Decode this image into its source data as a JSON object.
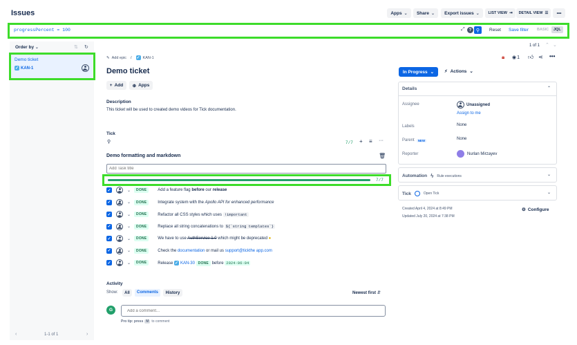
{
  "header": {
    "title": "Issues",
    "apps_label": "Apps",
    "share_label": "Share",
    "export_label": "Export issues",
    "list_view_label": "LIST VIEW",
    "detail_view_label": "DETAIL VIEW",
    "more_label": "•••"
  },
  "search": {
    "query": "progressPercent = 100",
    "reset_label": "Reset",
    "save_filter_label": "Save filter",
    "basic_label": "BASIC",
    "jql_label": "JQL"
  },
  "sidebar": {
    "order_by_label": "Order by",
    "items": [
      {
        "title": "Demo ticket",
        "key": "KAN-1"
      }
    ],
    "pagination": "1-1 of 1"
  },
  "issue": {
    "breadcrumb_add_epic": "Add epic",
    "breadcrumb_key": "KAN-1",
    "title": "Demo ticket",
    "add_label": "Add",
    "apps_label": "Apps",
    "description_heading": "Description",
    "description_text": "This ticket will be used to created demo videos for Tick documentation.",
    "pager": "1 of 1",
    "watchers": "1"
  },
  "tick": {
    "heading": "Tick",
    "count": "7/7",
    "list_title": "Demo formatting and markdown",
    "add_task_placeholder": "Add Task title",
    "progress_text": "7/7",
    "progress_percent": 100,
    "done_label": "DONE",
    "tasks": [
      {
        "a": "Add a feature flag ",
        "b": "before",
        "c": " our ",
        "d": "release"
      },
      {
        "a": "Integrate system with the ",
        "b": "Apollo API",
        "c": " for enhanced performance"
      },
      {
        "a": "Refactor all CSS styles which uses ",
        "code": "!important"
      },
      {
        "a": "Replace all string concatenations to ",
        "code": "${`string templates`}"
      },
      {
        "a": "We have to use ",
        "strike": "AuthService 1.0",
        "c": " which might be deprecated"
      },
      {
        "a": "Check the ",
        "link1": "documentation",
        "b": " or mail us ",
        "link2": "support@tickthe app.com"
      },
      {
        "a": "Release ",
        "key": "KAN-30",
        "status": "DONE",
        "b": " before ",
        "date": "2024-06-04"
      }
    ]
  },
  "activity": {
    "heading": "Activity",
    "show_label": "Show:",
    "tabs": [
      "All",
      "Comments",
      "History"
    ],
    "sort_label": "Newest first",
    "comment_placeholder": "Add a comment...",
    "avatar_initial": "G",
    "tip": "Pro tip: press",
    "tip_key": "M",
    "tip_tail": "to comment"
  },
  "right": {
    "status_label": "In Progress",
    "actions_label": "Actions",
    "details_heading": "Details",
    "assignee_label": "Assignee",
    "assignee_value": "Unassigned",
    "assign_to_me": "Assign to me",
    "labels_label": "Labels",
    "labels_value": "None",
    "parent_label": "Parent",
    "parent_badge": "NEW",
    "parent_value": "None",
    "reporter_label": "Reporter",
    "reporter_value": "Nurlan Mirzayev",
    "automation_label": "Automation",
    "rule_executions": "Rule executions",
    "tick_label": "Tick",
    "open_tick": "Open Tick",
    "created": "Created April 4, 2024 at 8:49 PM",
    "updated": "Updated July 20, 2024 at 7:38 PM",
    "configure_label": "Configure"
  }
}
